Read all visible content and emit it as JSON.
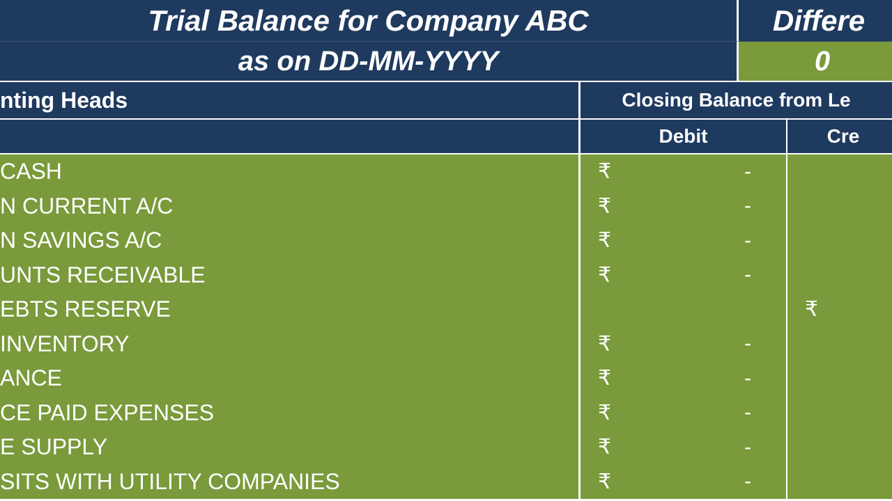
{
  "title": "Trial Balance for Company ABC",
  "subtitle": "as on DD-MM-YYYY",
  "diff_label": "Differe",
  "diff_value": "0",
  "col_heads": "nting Heads",
  "col_balance": "Closing Balance from Le",
  "col_debit": "Debit",
  "col_credit": "Cre",
  "currency": "₹",
  "dash": "-",
  "rows": [
    {
      "head": " CASH",
      "debit_cur": "₹",
      "debit_val": "-",
      "credit_cur": "",
      "credit_val": ""
    },
    {
      "head": "N CURRENT A/C",
      "debit_cur": "₹",
      "debit_val": "-",
      "credit_cur": "",
      "credit_val": ""
    },
    {
      "head": "N SAVINGS A/C",
      "debit_cur": "₹",
      "debit_val": "-",
      "credit_cur": "",
      "credit_val": ""
    },
    {
      "head": "UNTS RECEIVABLE",
      "debit_cur": "₹",
      "debit_val": "-",
      "credit_cur": "",
      "credit_val": ""
    },
    {
      "head": "EBTS RESERVE",
      "debit_cur": "",
      "debit_val": "",
      "credit_cur": "₹",
      "credit_val": ""
    },
    {
      "head": " INVENTORY",
      "debit_cur": "₹",
      "debit_val": "-",
      "credit_cur": "",
      "credit_val": ""
    },
    {
      "head": "ANCE",
      "debit_cur": "₹",
      "debit_val": "-",
      "credit_cur": "",
      "credit_val": ""
    },
    {
      "head": "CE PAID EXPENSES",
      "debit_cur": "₹",
      "debit_val": "-",
      "credit_cur": "",
      "credit_val": ""
    },
    {
      "head": "E SUPPLY",
      "debit_cur": "₹",
      "debit_val": "-",
      "credit_cur": "",
      "credit_val": ""
    },
    {
      "head": "SITS WITH UTILITY COMPANIES",
      "debit_cur": "₹",
      "debit_val": "-",
      "credit_cur": "",
      "credit_val": ""
    }
  ]
}
